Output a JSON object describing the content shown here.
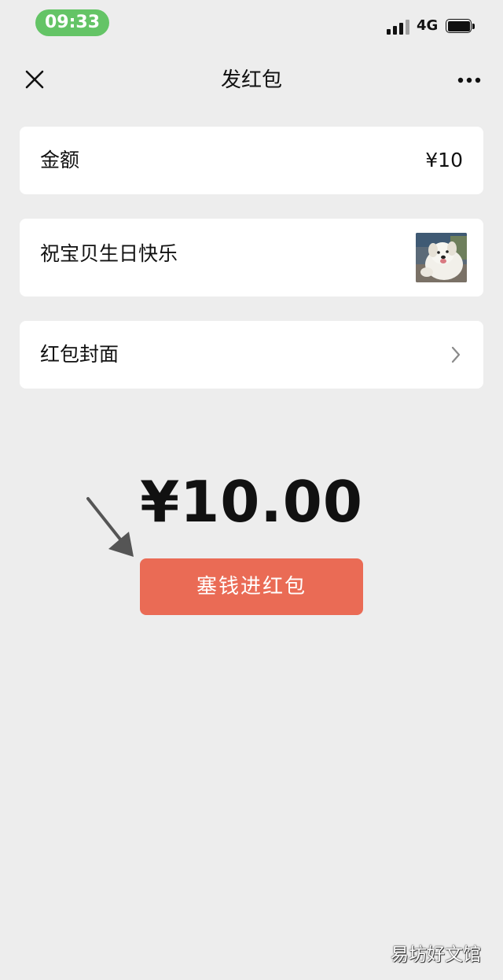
{
  "status_bar": {
    "time": "09:33",
    "network": "4G",
    "signal_icon": "signal-bars-icon",
    "battery_icon": "battery-icon",
    "time_pill_color": "#64c466"
  },
  "nav": {
    "title": "发红包",
    "close_icon": "close-icon",
    "more_icon": "more-dots-icon"
  },
  "amount_row": {
    "label": "金额",
    "value": "¥10"
  },
  "blessing_row": {
    "text": "祝宝贝生日快乐",
    "sticker_icon": "dog-sticker-image"
  },
  "cover_row": {
    "label": "红包封面",
    "chevron_icon": "chevron-right-icon"
  },
  "total_amount": "¥10.00",
  "send_button": {
    "label": "塞钱进红包",
    "color": "#ea6b55"
  },
  "annotation_icon": "arrow-pointer-icon",
  "watermark": "易坊好文馆"
}
